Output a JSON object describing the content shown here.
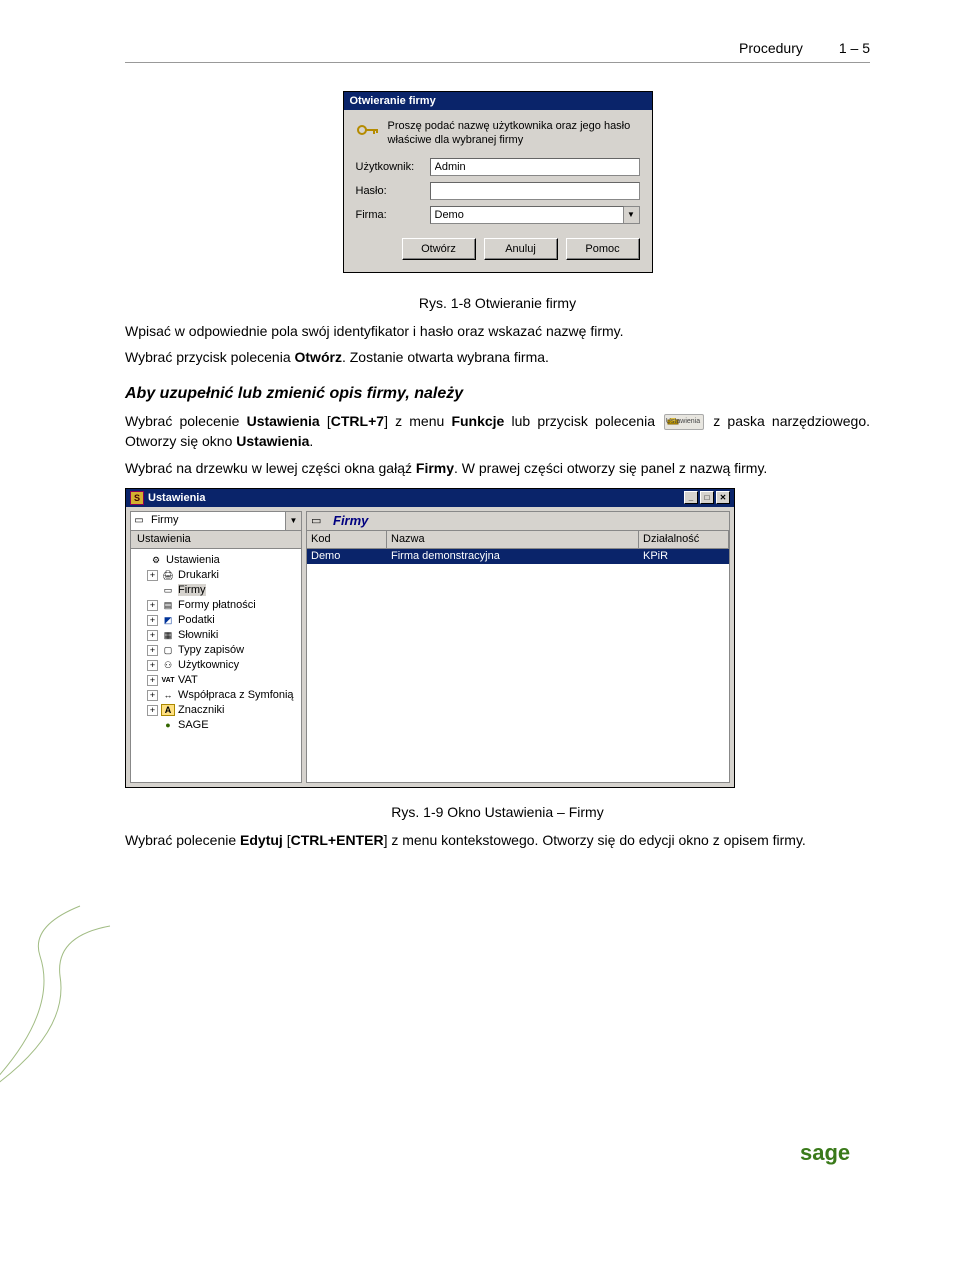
{
  "header": {
    "title": "Procedury",
    "page": "1 – 5"
  },
  "dialog1": {
    "title": "Otwieranie firmy",
    "prompt": "Proszę podać nazwę użytkownika oraz jego hasło właściwe dla wybranej firmy",
    "labels": {
      "user": "Użytkownik:",
      "pass": "Hasło:",
      "firm": "Firma:"
    },
    "values": {
      "user": "Admin",
      "pass": "",
      "firm": "Demo"
    },
    "buttons": {
      "open": "Otwórz",
      "cancel": "Anuluj",
      "help": "Pomoc"
    }
  },
  "caption1": "Rys. 1-8 Otwieranie firmy",
  "para1_a": "Wpisać w odpowiednie pola swój identyfikator i hasło oraz wskazać nazwę firmy.",
  "para1_b_pre": "Wybrać przycisk polecenia ",
  "para1_b_bold": "Otwórz",
  "para1_b_post": ". Zostanie otwarta wybrana firma.",
  "heading2": "Aby uzupełnić lub zmienić opis firmy, należy",
  "para2_pre": "Wybrać polecenie ",
  "para2_b1": "Ustawienia",
  "para2_mid1": " [",
  "para2_b2": "CTRL+7",
  "para2_mid2": "] z menu ",
  "para2_b3": "Funkcje",
  "para2_mid3": " lub przycisk polecenia ",
  "para2_icon_lbl": "Ustawienia",
  "para2_post": " z paska narzędziowego. Otworzy się okno ",
  "para2_b4": "Ustawienia",
  "para2_end": ".",
  "para3_pre": "Wybrać na drzewku w lewej części okna gałąź ",
  "para3_b1": "Firmy",
  "para3_post": ". W prawej części otworzy się panel z nazwą firmy.",
  "dialog2": {
    "title": "Ustawienia",
    "left_combo": "Firmy",
    "left_header": "Ustawienia",
    "tree": [
      {
        "exp": "",
        "icon": "gear",
        "label": "Ustawienia"
      },
      {
        "exp": "+",
        "icon": "printer",
        "label": "Drukarki"
      },
      {
        "exp": "",
        "icon": "box-sel",
        "label": "Firmy",
        "selected": true
      },
      {
        "exp": "+",
        "icon": "doc",
        "label": "Formy płatności"
      },
      {
        "exp": "+",
        "icon": "blue",
        "label": "Podatki"
      },
      {
        "exp": "+",
        "icon": "dict",
        "label": "Słowniki"
      },
      {
        "exp": "+",
        "icon": "page",
        "label": "Typy zapisów"
      },
      {
        "exp": "+",
        "icon": "users",
        "label": "Użytkownicy"
      },
      {
        "exp": "+",
        "icon": "vat",
        "label": "VAT"
      },
      {
        "exp": "+",
        "icon": "link",
        "label": "Współpraca z Symfonią"
      },
      {
        "exp": "+",
        "icon": "a",
        "label": "Znaczniki"
      },
      {
        "exp": "",
        "icon": "ball",
        "label": "SAGE"
      }
    ],
    "right_title": "Firmy",
    "columns": {
      "c1": "Kod",
      "c2": "Nazwa",
      "c3": "Działalność"
    },
    "row": {
      "c1": "Demo",
      "c2": "Firma demonstracyjna",
      "c3": "KPiR"
    }
  },
  "caption2_pre": "Rys. 1-9 Okno ",
  "caption2_b": "Ustawienia – Firmy",
  "para4_pre": "Wybrać polecenie ",
  "para4_b1": "Edytuj",
  "para4_mid1": " [",
  "para4_b2": "CTRL+ENTER",
  "para4_mid2": "] z menu kontekstowego. Otworzy się do edycji okno z opisem firmy.",
  "logo": "sage"
}
